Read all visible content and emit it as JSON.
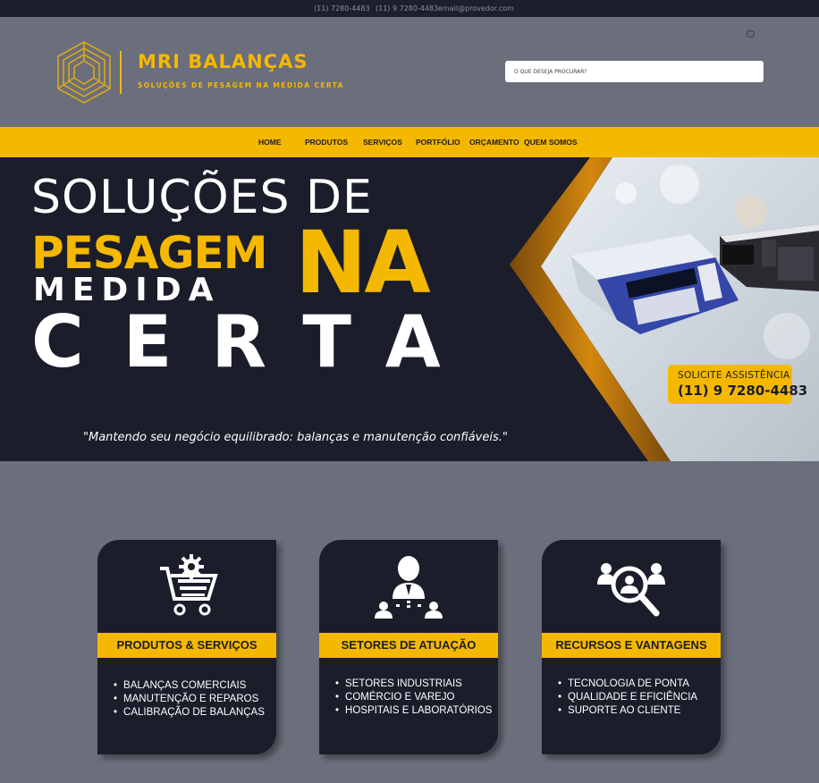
{
  "topbar": {
    "phone1": "(11) 7280-4483",
    "phone2": "(11) 9 7280-4483",
    "email": "email@provedor.com"
  },
  "header": {
    "brand": "MRI BALANÇAS",
    "tagline": "SOLUÇÕES DE PESAGEM NA MEDIDA CERTA",
    "search_placeholder": "O QUE DESEJA PROCURAR?",
    "user_icon": "user-icon"
  },
  "nav": {
    "items": [
      "HOME",
      "PRODUTOS",
      "SERVIÇOS",
      "PORTFÓLIO",
      "ORÇAMENTO",
      "QUEM SOMOS"
    ]
  },
  "hero": {
    "line1": "SOLUÇÕES DE",
    "line2": "PESAGEM",
    "line3": "MEDIDA",
    "line4": "NA",
    "line5": "CERTA",
    "quote": "\"Mantendo seu negócio equilibrado: balanças e manutenção confiáveis.\"",
    "cta_label": "SOLICITE ASSISTÊNCIA",
    "cta_phone": "(11) 9 7280-4483"
  },
  "cards": [
    {
      "icon": "cart-gear-icon",
      "title": "PRODUTOS & SERVIÇOS",
      "items": [
        "BALANÇAS COMERCIAIS",
        "MANUTENÇÃO E REPAROS",
        "CALIBRAÇÃO DE BALANÇAS"
      ]
    },
    {
      "icon": "business-people-icon",
      "title": "SETORES DE ATUAÇÃO",
      "items": [
        "SETORES INDUSTRIAIS",
        "COMÉRCIO E VAREJO",
        "HOSPITAIS E LABORATÓRIOS"
      ]
    },
    {
      "icon": "search-people-icon",
      "title": "RECURSOS E VANTAGENS",
      "items": [
        "TECNOLOGIA DE PONTA",
        "QUALIDADE E EFICIÊNCIA",
        "SUPORTE AO CLIENTE"
      ]
    }
  ],
  "colors": {
    "accent": "#f5b800",
    "dark": "#1b1d2b",
    "page_bg": "#6b6e7b"
  }
}
